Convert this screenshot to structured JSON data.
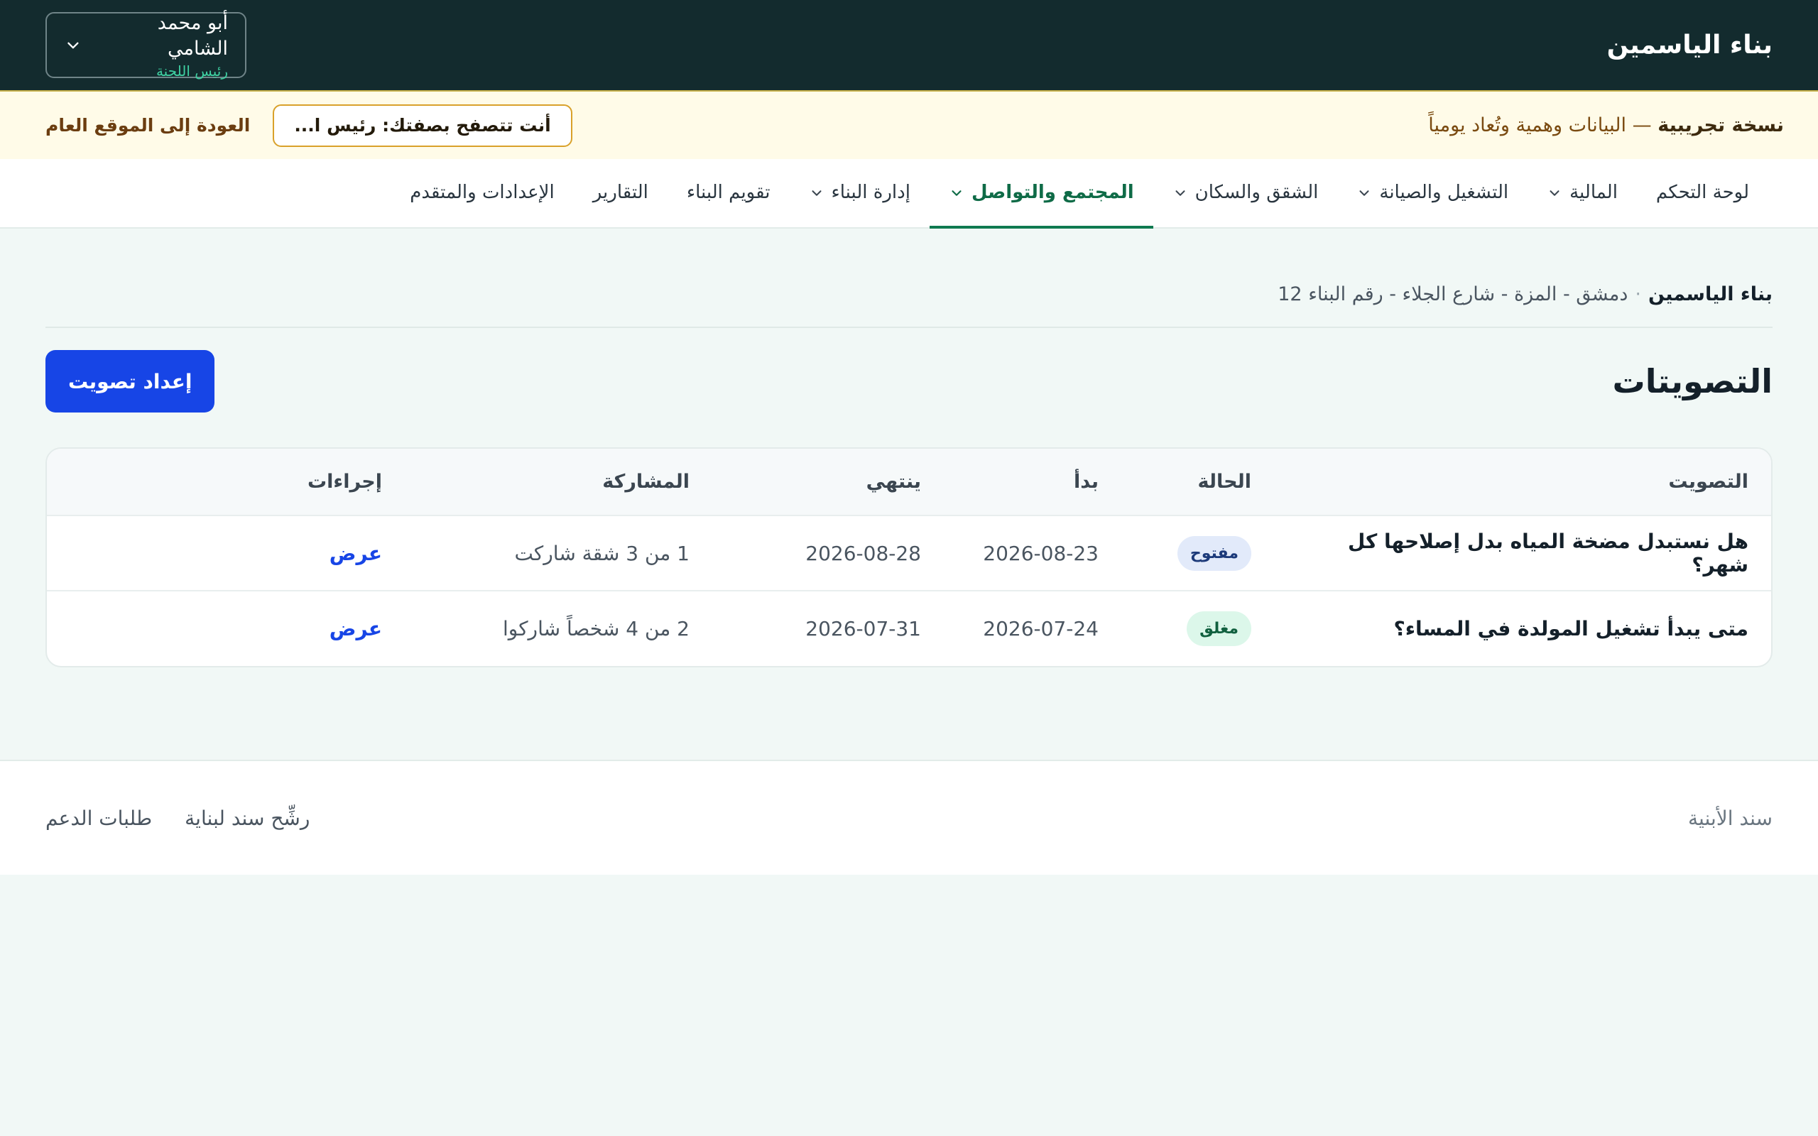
{
  "header": {
    "brand": "بناء الياسمين",
    "user_name": "أبو محمد الشامي",
    "user_role": "رئيس اللجنة"
  },
  "banner": {
    "label_bold": "نسخة تجريبية",
    "label_rest": " — البيانات وهمية وتُعاد يومياً",
    "browse_as": "أنت تتصفح بصفتك: رئيس ا...",
    "back_link": "العودة إلى الموقع العام"
  },
  "nav": {
    "items": [
      {
        "label": "لوحة التحكم"
      },
      {
        "label": "المالية"
      },
      {
        "label": "التشغيل والصيانة"
      },
      {
        "label": "الشقق والسكان"
      },
      {
        "label": "المجتمع والتواصل"
      },
      {
        "label": "إدارة البناء"
      },
      {
        "label": "تقويم البناء"
      },
      {
        "label": "التقارير"
      },
      {
        "label": "الإعدادات والمتقدم"
      }
    ],
    "active_index": 4
  },
  "breadcrumb": {
    "building": "بناء الياسمين",
    "separator": "·",
    "address": "دمشق - المزة - شارع الجلاء - رقم البناء 12"
  },
  "page": {
    "title": "التصويتات",
    "new_vote_button": "إعداد تصويت"
  },
  "table": {
    "headers": {
      "vote": "التصويت",
      "status": "الحالة",
      "start": "بدأ",
      "end": "ينتهي",
      "participation": "المشاركة",
      "actions": "إجراءات"
    },
    "rows": [
      {
        "question": "هل نستبدل مضخة المياه بدل إصلاحها كل شهر؟",
        "status": "مفتوح",
        "start": "2026-08-23",
        "end": "2026-08-28",
        "participation": "1 من 3 شقة شاركت",
        "action": "عرض"
      },
      {
        "question": "متى يبدأ تشغيل المولدة في المساء؟",
        "status": "مغلق",
        "start": "2026-07-24",
        "end": "2026-07-31",
        "participation": "2 من 4 شخصاً شاركوا",
        "action": "عرض"
      }
    ]
  },
  "footer": {
    "brand": "سند الأبنية",
    "links": [
      {
        "label": "رشِّح سند لبناية"
      },
      {
        "label": "طلبات الدعم"
      }
    ]
  },
  "colors": {
    "topbar_bg": "#132b2e",
    "accent_green": "#0f7a50",
    "primary_blue": "#1745e6",
    "banner_bg": "#fffbe8",
    "page_bg": "#f1f8f6"
  }
}
